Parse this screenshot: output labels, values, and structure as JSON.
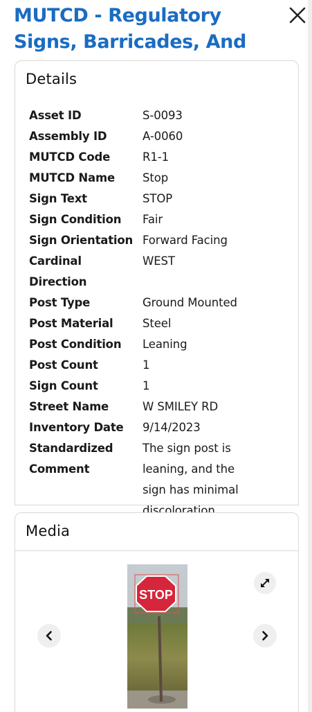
{
  "header": {
    "title": "MUTCD - Regulatory Signs, Barricades, And Gates",
    "close_icon": "close-icon"
  },
  "details": {
    "heading": "Details",
    "rows": [
      {
        "label": "Asset ID",
        "value": "S-0093"
      },
      {
        "label": "Assembly ID",
        "value": "A-0060"
      },
      {
        "label": "MUTCD Code",
        "value": "R1-1"
      },
      {
        "label": "MUTCD Name",
        "value": "Stop"
      },
      {
        "label": "Sign Text",
        "value": "STOP"
      },
      {
        "label": "Sign Condition",
        "value": "Fair"
      },
      {
        "label": "Sign Orientation",
        "value": "Forward Facing"
      },
      {
        "label": "Cardinal Direction",
        "value": "WEST"
      },
      {
        "label": "Post Type",
        "value": "Ground Mounted"
      },
      {
        "label": "Post Material",
        "value": "Steel"
      },
      {
        "label": "Post Condition",
        "value": "Leaning"
      },
      {
        "label": "Post Count",
        "value": "1"
      },
      {
        "label": "Sign Count",
        "value": "1"
      },
      {
        "label": "Street Name",
        "value": "W SMILEY RD"
      },
      {
        "label": "Inventory Date",
        "value": "9/14/2023"
      },
      {
        "label": "Standardized Comment",
        "value": "The sign post is leaning, and the sign has minimal discoloration."
      }
    ]
  },
  "media": {
    "heading": "Media",
    "photo_sign_text": "STOP",
    "icons": {
      "prev": "chevron-left-icon",
      "next": "chevron-right-icon",
      "expand": "expand-icon"
    }
  },
  "colors": {
    "title_blue": "#1a6cc2",
    "stop_red": "#d6263b",
    "border": "#d8d8d8"
  }
}
